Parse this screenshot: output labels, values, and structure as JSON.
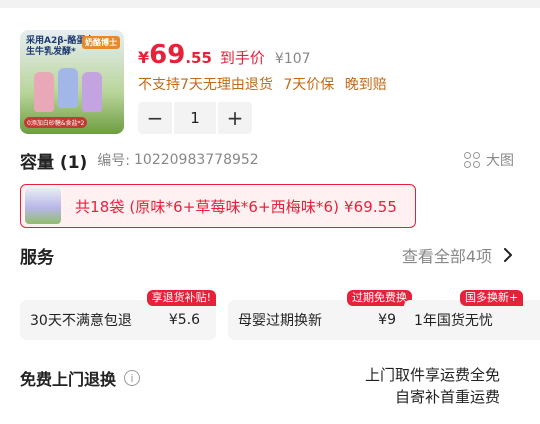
{
  "product": {
    "image_tagline": "采用A2β-酪蛋白\n生牛乳发酵*",
    "image_brand": "奶酪博士",
    "image_bottom_tag": "0添加白砂糖&食盐*2",
    "currency": "¥",
    "price_int": "69",
    "price_dec": ".55",
    "price_note": "到手价",
    "orig_price": "¥107",
    "policy": "不支持7天无理由退货 7天价保 晚到赔"
  },
  "stepper": {
    "minus": "−",
    "quantity": "1",
    "plus": "+"
  },
  "capacity": {
    "label": "容量 (1)",
    "code_label": "编号:",
    "code": "10220983778952",
    "big_image": "大图"
  },
  "variant": {
    "label": "共18袋 (原味*6+草莓味*6+西梅味*6) ¥69.55"
  },
  "service": {
    "title": "服务",
    "more": "查看全部4项",
    "cards": [
      {
        "badge": "享退货补贴!",
        "text": "30天不满意包退",
        "price": "¥5.6"
      },
      {
        "badge": "过期免费换",
        "text": "母婴过期换新",
        "price": "¥9"
      },
      {
        "badge": "国多换新+",
        "text": "1年国货无忧",
        "price": ""
      }
    ]
  },
  "returns": {
    "title": "免费上门退换",
    "info": "i",
    "desc_line1": "上门取件享运费全免",
    "desc_line2": "自寄补首重运费"
  },
  "colors": {
    "accent": "#e8213b",
    "policy": "#c26a17",
    "muted": "#888888"
  }
}
